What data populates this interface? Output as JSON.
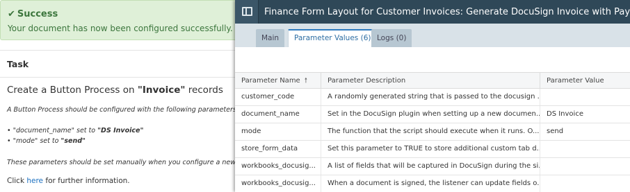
{
  "alert": {
    "icon": "check-icon",
    "title": "Success",
    "message": "Your document has now been configured successfully. Ple"
  },
  "task": {
    "heading": "Task",
    "title_prefix": "Create a Button Process on ",
    "title_bold": "\"Invoice\"",
    "title_suffix": " records",
    "intro": "A Button Process should be configured with the following parameters set:",
    "param1_prefix": "• \"document_name\" set to ",
    "param1_value": "\"DS Invoice\"",
    "param2_prefix": "• \"mode\" set to ",
    "param2_value": "\"send\"",
    "note": "These parameters should be set manually when you configure a new Proce",
    "click_prefix": "Click ",
    "click_link": "here",
    "click_suffix": " for further information."
  },
  "modal": {
    "panel_icon": "sidebar-panel-icon",
    "title": "Finance Form Layout for Customer Invoices: Generate DocuSign Invoice with Payment Pr",
    "tabs": [
      {
        "label": "Main",
        "active": false
      },
      {
        "label": "Parameter Values (6)",
        "active": true
      },
      {
        "label": "Logs (0)",
        "active": false
      }
    ],
    "table": {
      "columns": [
        "Parameter Name",
        "Parameter Description",
        "Parameter Value"
      ],
      "sort_icon": "sort-ascending-icon",
      "rows": [
        {
          "name": "customer_code",
          "description": "A randomly generated string that is passed to the docusign ...",
          "value": ""
        },
        {
          "name": "document_name",
          "description": "Set in the DocuSign plugin when setting up a new documen...",
          "value": "DS Invoice"
        },
        {
          "name": "mode",
          "description": "The function that the script should execute when it runs. O...",
          "value": "send"
        },
        {
          "name": "store_form_data",
          "description": "Set this parameter to TRUE to store additional custom tab d...",
          "value": ""
        },
        {
          "name": "workbooks_docusig...",
          "description": "A list of fields that will be captured in DocuSign during the si...",
          "value": ""
        },
        {
          "name": "workbooks_docusig...",
          "description": "When a document is signed, the listener can update fields o...",
          "value": ""
        }
      ]
    }
  }
}
